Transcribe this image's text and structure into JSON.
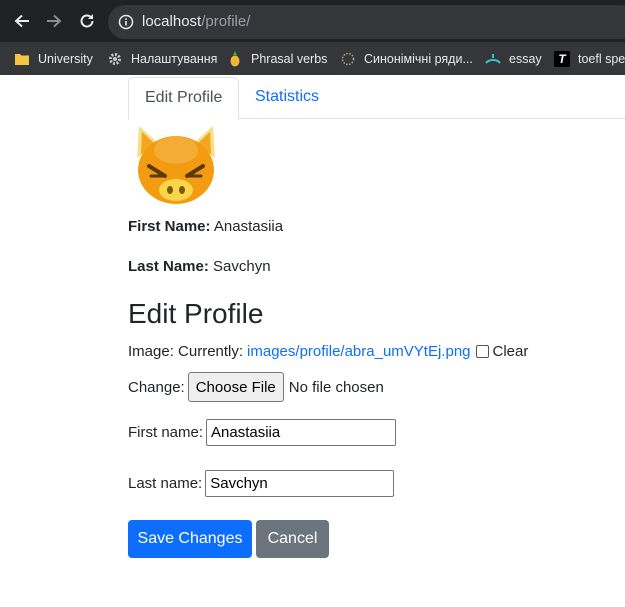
{
  "browser": {
    "url_host": "localhost",
    "url_path": "/profile/",
    "bookmarks": [
      {
        "label": "University",
        "icon": "folder-icon"
      },
      {
        "label": "Налаштування",
        "icon": "gear-icon"
      },
      {
        "label": "Phrasal verbs",
        "icon": "pineapple-icon"
      },
      {
        "label": "Синонімічні ряди...",
        "icon": "sparkle-icon"
      },
      {
        "label": "essay",
        "icon": "diving-icon"
      },
      {
        "label": "toefl spe",
        "icon": "t-icon"
      }
    ]
  },
  "tabs": [
    {
      "label": "Edit Profile",
      "active": true
    },
    {
      "label": "Statistics",
      "active": false
    }
  ],
  "profile": {
    "first_name_label": "First Name:",
    "first_name": "Anastasiia",
    "last_name_label": "Last Name:",
    "last_name": "Savchyn"
  },
  "form": {
    "heading": "Edit Profile",
    "image_label": "Image: Currently:",
    "image_link": "images/profile/abra_umVYtEj.png",
    "clear_label": "Clear",
    "change_label": "Change:",
    "choose_file_label": "Choose File",
    "no_file_text": "No file chosen",
    "first_name_label": "First name:",
    "first_name_value": "Anastasiia",
    "last_name_label": "Last name:",
    "last_name_value": "Savchyn",
    "save_label": "Save Changes",
    "cancel_label": "Cancel"
  },
  "colors": {
    "primary": "#0d6efd",
    "secondary": "#6c757d",
    "chrome_dark": "#202124"
  }
}
